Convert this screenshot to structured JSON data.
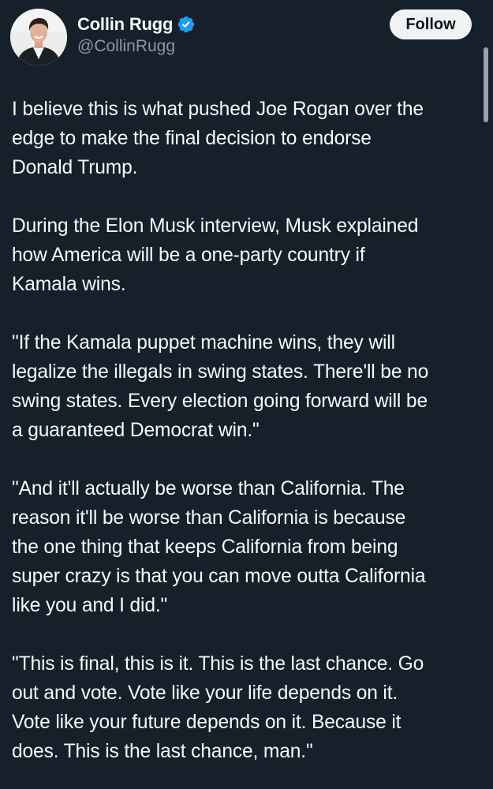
{
  "author": {
    "display_name": "Collin Rugg",
    "handle": "@CollinRugg",
    "verified": true,
    "avatar_icon": "profile-photo"
  },
  "actions": {
    "follow_label": "Follow"
  },
  "tweet": {
    "paragraphs": [
      "I believe this is what pushed Joe Rogan over the\nedge to make the final decision to endorse\nDonald Trump.",
      "During the Elon Musk interview, Musk explained\nhow America will be a one-party country if\nKamala wins.",
      "\"If the Kamala puppet machine wins, they will\nlegalize the illegals in swing states. There'll be no\nswing states. Every election going forward will be\na guaranteed Democrat win.\"",
      "\"And it'll actually be worse than California. The\nreason it'll be worse than California is because\nthe one thing that keeps California from being\nsuper crazy is that you can move outta California\nlike you and I did.\"",
      "\"This is final, this is it. This is the last chance. Go\nout and vote. Vote like your life depends on it.\nVote like your future depends on it. Because it\ndoes. This is the last chance, man.\""
    ]
  },
  "colors": {
    "background": "#15202b",
    "text_primary": "#f7f9f9",
    "text_secondary": "#8b98a5",
    "verified_badge": "#1d9bf0",
    "follow_button_bg": "#eff3f4",
    "follow_button_text": "#0f1419"
  }
}
